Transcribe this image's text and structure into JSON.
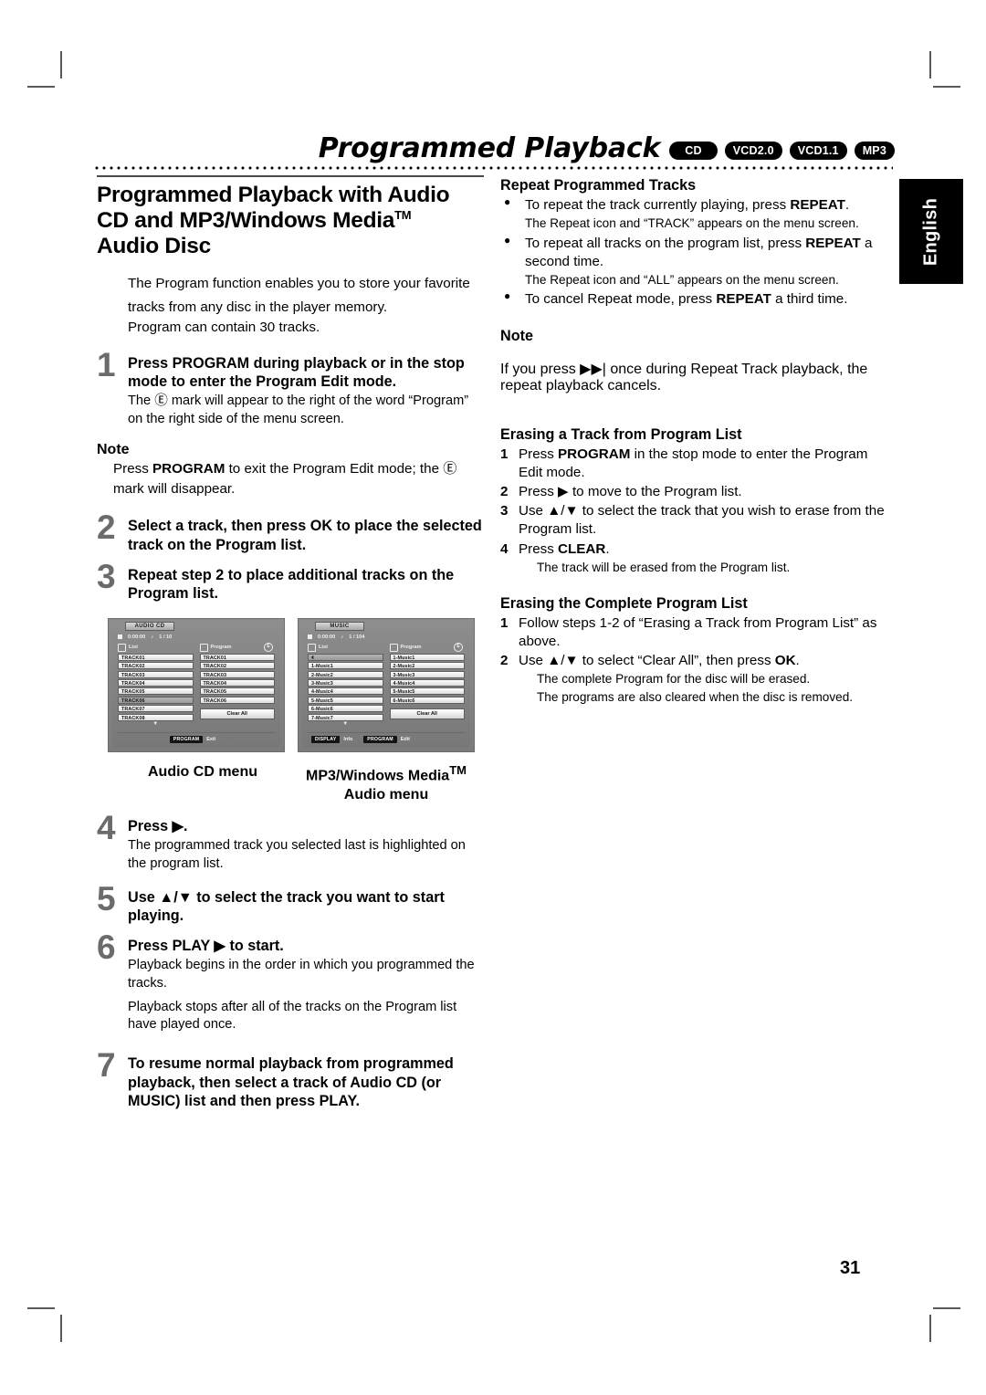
{
  "header": {
    "title": "Programmed Playback",
    "badges": [
      "CD",
      "VCD2.0",
      "VCD1.1",
      "MP3"
    ]
  },
  "side_tab": {
    "label": "English"
  },
  "page_number": "31",
  "left_column": {
    "section_title_line1": "Programmed Playback with Audio",
    "section_title_line2_a": "CD and MP3/Windows Media",
    "section_title_tm": "TM",
    "section_title_line3": "Audio Disc",
    "intro": [
      "The Program function enables you to store your favorite",
      "tracks from any disc in the player memory.",
      "Program can contain 30 tracks."
    ],
    "steps": [
      {
        "num": "1",
        "lead_prefix": "Press ",
        "lead_bold": "PROGRAM",
        "lead_suffix": " during playback or in the stop mode to enter the Program Edit mode.",
        "sub": "The Ⓔ  mark will appear to the right of the word “Program” on the right side of the menu screen."
      },
      {
        "num": "2",
        "lead_prefix": "Select a track, then press ",
        "lead_bold": "OK",
        "lead_suffix": " to place the selected track on the Program list.",
        "sub": ""
      },
      {
        "num": "3",
        "lead_prefix": "Repeat step 2 to place additional tracks on the Program list.",
        "lead_bold": "",
        "lead_suffix": "",
        "sub": ""
      },
      {
        "num": "4",
        "lead_prefix": "Press ▶.",
        "lead_bold": "",
        "lead_suffix": "",
        "sub": "The programmed track you selected last is highlighted on the program list."
      },
      {
        "num": "5",
        "lead_prefix": "Use ▲/▼ to select the track you want to start playing.",
        "lead_bold": "",
        "lead_suffix": "",
        "sub": ""
      },
      {
        "num": "6",
        "lead_prefix": "Press PLAY ▶ to start.",
        "lead_bold": "",
        "lead_suffix": "",
        "sub": "Playback begins in the order in which you programmed the tracks.",
        "sub2": "Playback stops after all of the tracks on the Program list have played once."
      },
      {
        "num": "7",
        "lead_prefix": "To resume normal playback from programmed playback, then select a track of Audio CD (or MUSIC) list and then press PLAY.",
        "lead_bold": "",
        "lead_suffix": "",
        "sub": ""
      }
    ],
    "note1": {
      "title": "Note",
      "body_prefix": "Press ",
      "body_bold": "PROGRAM",
      "body_suffix": " to exit the Program Edit mode; the Ⓔ mark will disappear."
    },
    "captions": {
      "audio_cd": "Audio CD menu",
      "mp3_line1": "MP3/Windows Media",
      "mp3_tm": "TM",
      "mp3_line2": "Audio menu"
    },
    "screenshots": [
      {
        "tab": "AUDIO CD",
        "status_time": "0:00:00",
        "status_track": "1 / 10",
        "list_header": "List",
        "program_header": "Program",
        "program_mark": "E",
        "list_items": [
          "TRACK01",
          "TRACK02",
          "TRACK03",
          "TRACK04",
          "TRACK05",
          "TRACK06",
          "TRACK07",
          "TRACK08"
        ],
        "list_selected_index": 5,
        "program_items": [
          "TRACK01",
          "TRACK02",
          "TRACK03",
          "TRACK04",
          "TRACK05",
          "TRACK06"
        ],
        "clear_all": "Clear All",
        "footer_keys": [
          {
            "key": "PROGRAM",
            "label": "Exit"
          }
        ]
      },
      {
        "tab": "MUSIC",
        "status_time": "0:00:00",
        "status_track": "1 / 104",
        "list_header": "List",
        "program_header": "Program",
        "program_mark": "E",
        "list_items": [
          "",
          "1-Music1",
          "2-Music2",
          "3-Music3",
          "4-Music4",
          "5-Music5",
          "6-Music6",
          "7-Music7"
        ],
        "list_selected_index": 0,
        "program_items": [
          "1-Music1",
          "2-Music2",
          "3-Music3",
          "4-Music4",
          "5-Music5",
          "6-Music6"
        ],
        "clear_all": "Clear All",
        "footer_keys": [
          {
            "key": "DISPLAY",
            "label": "Info"
          },
          {
            "key": "PROGRAM",
            "label": "Edit"
          }
        ]
      }
    ]
  },
  "right_column": {
    "repeat_section": {
      "heading": "Repeat Programmed Tracks",
      "bullets": [
        {
          "text_prefix": "To repeat the track currently playing, press ",
          "bold": "REPEAT",
          "text_suffix": ".",
          "note": "The Repeat icon and “TRACK” appears on the menu screen."
        },
        {
          "text_prefix": "To repeat all tracks on the program list, press ",
          "bold": "REPEAT",
          "text_suffix": " a second time.",
          "note": "The Repeat icon and “ALL” appears on the menu screen."
        },
        {
          "text_prefix": "To cancel Repeat mode, press ",
          "bold": "REPEAT",
          "text_suffix": " a third time.",
          "note": ""
        }
      ]
    },
    "note": {
      "title": "Note",
      "body": "If you press ▶▶| once during Repeat Track playback, the repeat playback cancels."
    },
    "erase_track_section": {
      "heading": "Erasing a Track from Program List",
      "items": [
        {
          "n": "1",
          "prefix": "Press ",
          "bold": "PROGRAM",
          "suffix": " in the stop mode to enter the Program Edit  mode.",
          "note": ""
        },
        {
          "n": "2",
          "prefix": "Press ▶ to move to the Program list.",
          "bold": "",
          "suffix": "",
          "note": ""
        },
        {
          "n": "3",
          "prefix": "Use ▲/▼ to select the track that you wish to erase from the Program list.",
          "bold": "",
          "suffix": "",
          "note": ""
        },
        {
          "n": "4",
          "prefix": "Press ",
          "bold": "CLEAR",
          "suffix": ".",
          "note": "The track will be erased from the Program list."
        }
      ]
    },
    "erase_all_section": {
      "heading": "Erasing the Complete Program List",
      "items": [
        {
          "n": "1",
          "prefix": "Follow steps 1-2 of “Erasing a Track from Program List” as above.",
          "bold": "",
          "suffix": "",
          "note": ""
        },
        {
          "n": "2",
          "prefix": "Use ▲/▼ to select “Clear All”, then press ",
          "bold": "OK",
          "suffix": ".",
          "note": "The complete Program for the disc will be erased.",
          "note2": "The programs are also cleared when the disc is removed."
        }
      ]
    }
  }
}
